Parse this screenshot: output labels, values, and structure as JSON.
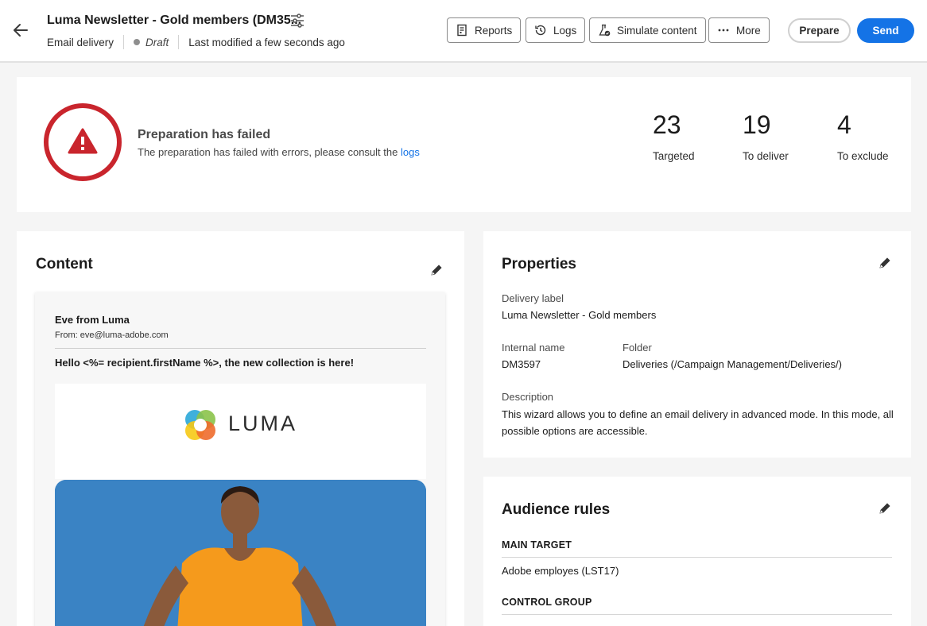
{
  "header": {
    "title": "Luma Newsletter - Gold members (DM35...",
    "channel": "Email delivery",
    "status": "Draft",
    "modified": "Last modified a few seconds ago",
    "actions": {
      "reports": "Reports",
      "logs": "Logs",
      "simulate": "Simulate content",
      "more": "More"
    },
    "prepare": "Prepare",
    "send": "Send",
    "accent_color": "#1473e6"
  },
  "status": {
    "title": "Preparation has failed",
    "message": "The preparation has failed with errors, please consult the ",
    "link": "logs",
    "error_color": "#c9252d",
    "stats": [
      {
        "value": "23",
        "label": "Targeted"
      },
      {
        "value": "19",
        "label": "To deliver"
      },
      {
        "value": "4",
        "label": "To exclude"
      }
    ]
  },
  "content": {
    "title": "Content",
    "email": {
      "sender": "Eve from Luma",
      "from": "From: eve@luma-adobe.com",
      "subject": "Hello <%= recipient.firstName %>, the new collection is here!",
      "logo_text": "LUMA"
    }
  },
  "properties": {
    "title": "Properties",
    "delivery_label_label": "Delivery label",
    "delivery_label_value": "Luma Newsletter - Gold members",
    "internal_name_label": "Internal name",
    "internal_name_value": "DM3597",
    "folder_label": "Folder",
    "folder_value": "Deliveries (/Campaign Management/Deliveries/)",
    "description_label": "Description",
    "description_value": "This wizard allows you to define an email delivery in advanced mode. In this mode, all possible options are accessible."
  },
  "audience": {
    "title": "Audience rules",
    "main_target_label": "MAIN TARGET",
    "main_target_value": "Adobe employes (LST17)",
    "control_group_label": "CONTROL GROUP"
  }
}
